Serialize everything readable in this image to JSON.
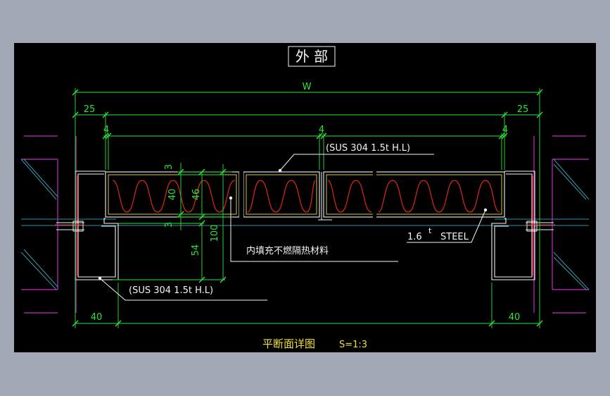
{
  "title": "外 部",
  "dimensions": {
    "overall": "W",
    "left_margin": "25",
    "right_margin": "25",
    "left_gap": "4",
    "center_gap": "4",
    "right_gap": "4",
    "top_edge": "3",
    "inner_40": "40",
    "inner_46": "46",
    "bottom_edge": "3",
    "depth_100": "100",
    "depth_54": "54",
    "bottom_left": "40",
    "bottom_right": "40"
  },
  "notes": {
    "sus_top": "(SUS 304 1.5t H.L)",
    "steel": "1.6",
    "steel_sup": "t",
    "steel_word": "STEEL",
    "infill": "内填充不燃隔热材料",
    "sus_bottom": "(SUS 304 1.5t H.L)"
  },
  "caption": {
    "text": "平断面详图",
    "scale": "S=1:3"
  },
  "colors": {
    "background": "#000000",
    "dimension": "#2fe23a",
    "insulation": "#e02818",
    "wall": "#c030c0",
    "panel_line": "#f4f4f4",
    "inner_line": "#f0e030",
    "hatch": "#40c8d8",
    "caption": "#f0e030"
  }
}
